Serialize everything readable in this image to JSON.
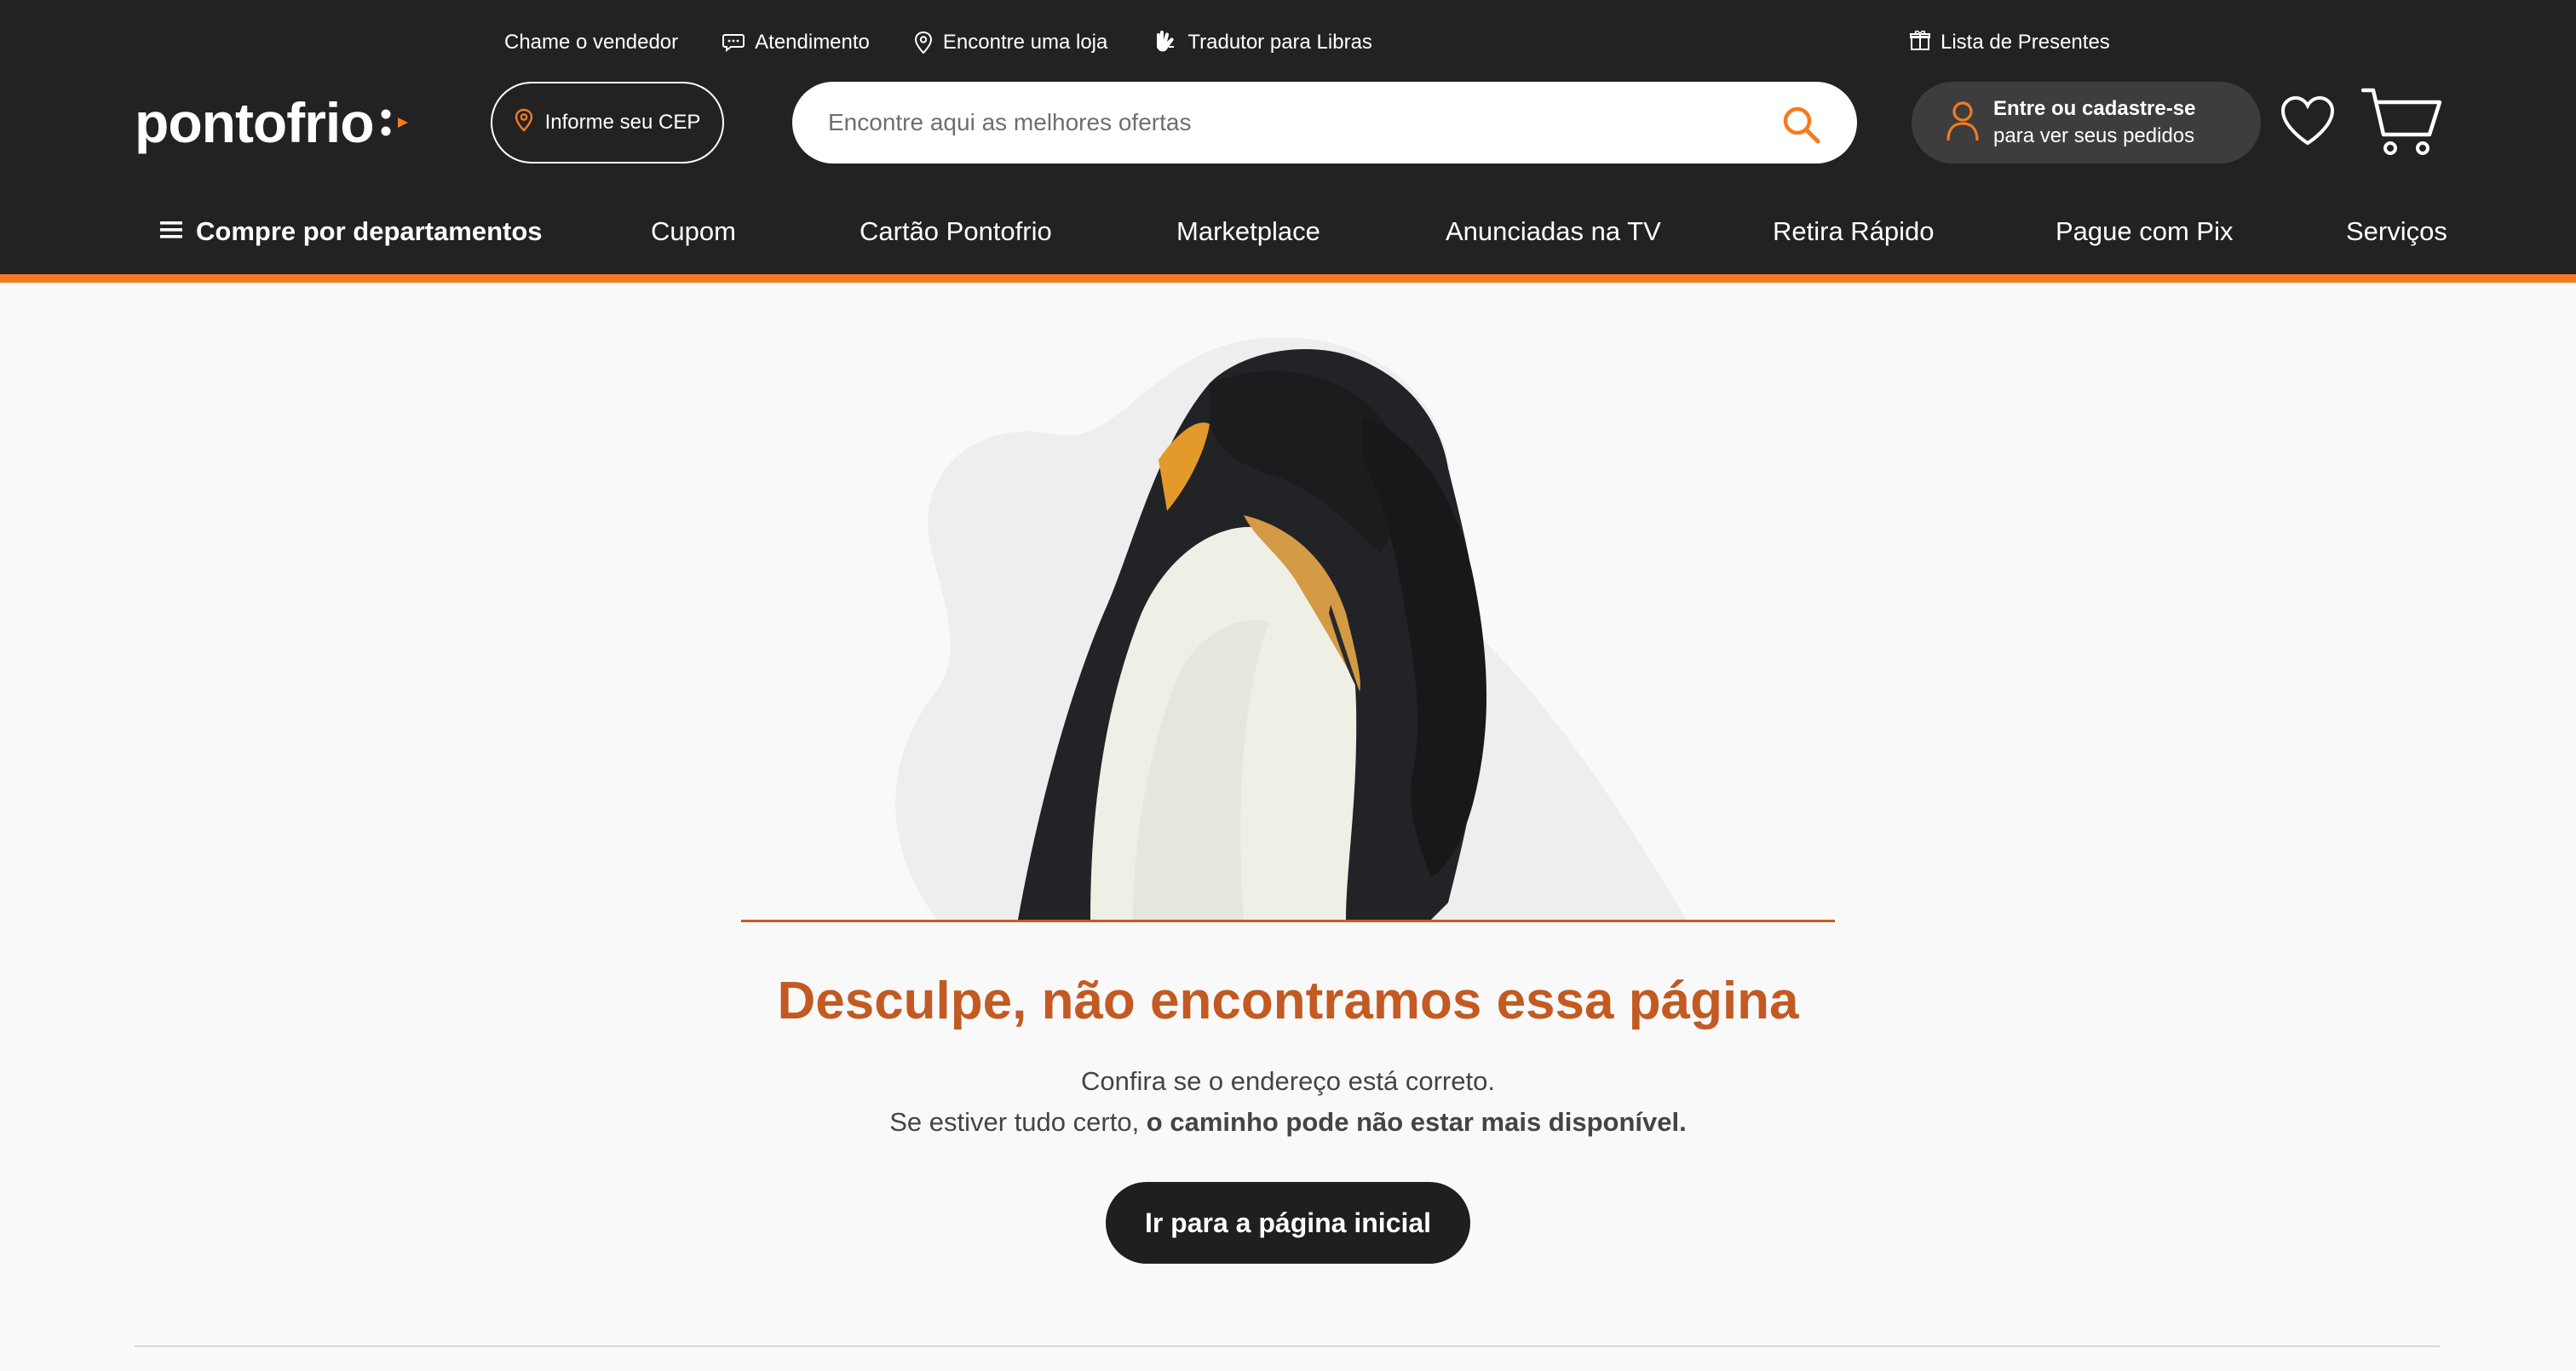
{
  "colors": {
    "header_bg": "#222222",
    "accent": "#f47b20",
    "title": "#c25a22",
    "button_dark": "#1f1f1f"
  },
  "topbar": {
    "items": [
      {
        "label": "Chame o vendedor",
        "icon": ""
      },
      {
        "label": "Atendimento",
        "icon": "chat-icon"
      },
      {
        "label": "Encontre uma loja",
        "icon": "location-pin-icon"
      },
      {
        "label": "Tradutor para Libras",
        "icon": "sign-language-hands-icon"
      }
    ],
    "gift_list": {
      "label": "Lista de Presentes",
      "icon": "gift-icon"
    }
  },
  "logo": {
    "text": "pontofrio"
  },
  "cep": {
    "label": "Informe seu CEP",
    "icon": "location-pin-icon"
  },
  "search": {
    "placeholder": "Encontre aqui as melhores ofertas",
    "value": "",
    "icon": "search-icon"
  },
  "account": {
    "line1": "Entre ou cadastre-se",
    "line2": "para ver seus pedidos",
    "icon": "user-icon"
  },
  "icons": {
    "wishlist": "heart-icon",
    "cart": "cart-icon"
  },
  "nav": {
    "departments": "Compre por departamentos",
    "items": [
      "Cupom",
      "Cartão Pontofrio",
      "Marketplace",
      "Anunciadas na TV",
      "Retira Rápido",
      "Pague com Pix",
      "Serviços"
    ]
  },
  "error": {
    "title": "Desculpe, não encontramos essa página",
    "line1": "Confira se o endereço está correto.",
    "line2_prefix": "Se estiver tudo certo, ",
    "line2_bold": "o caminho pode não estar mais disponível.",
    "button": "Ir para a página inicial"
  }
}
